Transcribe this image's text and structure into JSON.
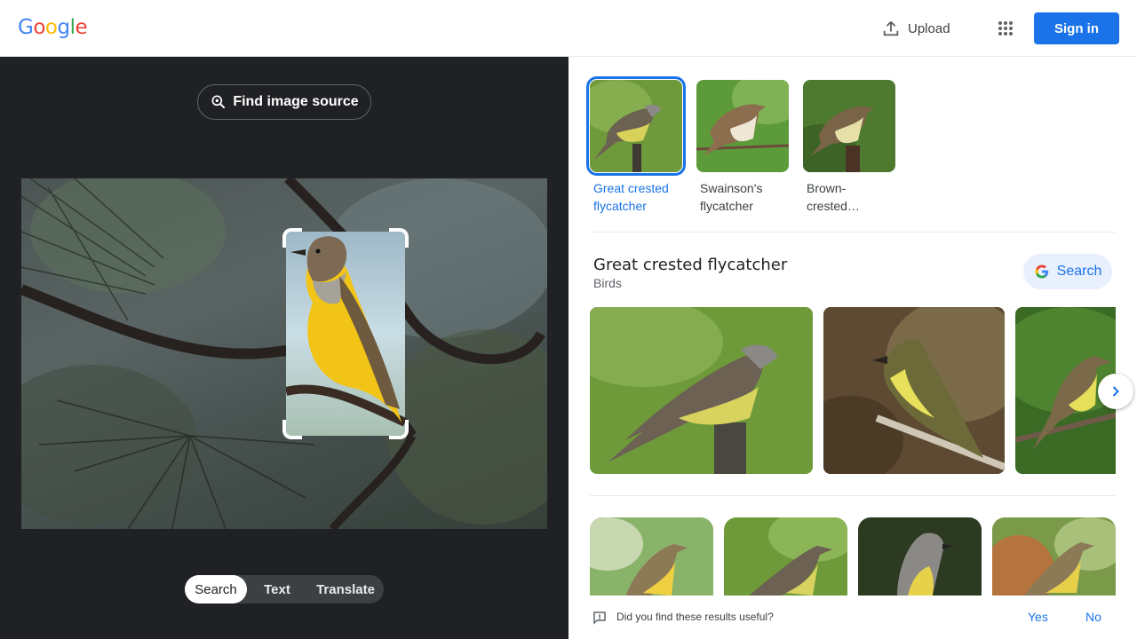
{
  "header": {
    "logo_letters": [
      "G",
      "o",
      "o",
      "g",
      "l",
      "e"
    ],
    "logo_colors": [
      "#4285f4",
      "#ea4335",
      "#fbbc05",
      "#4285f4",
      "#34a853",
      "#ea4335"
    ],
    "upload_label": "Upload",
    "signin_label": "Sign in"
  },
  "left_panel": {
    "find_source_label": "Find image source",
    "modes": [
      "Search",
      "Text",
      "Translate"
    ],
    "selected_mode": "Search"
  },
  "results": {
    "thumbs": [
      {
        "label": "Great crested flycatcher",
        "selected": true
      },
      {
        "label": "Swainson's flycatcher",
        "selected": false
      },
      {
        "label": "Brown-crested…",
        "selected": false
      }
    ],
    "entity": {
      "title": "Great crested flycatcher",
      "subtitle": "Birds",
      "search_label": "Search"
    },
    "feedback": {
      "question": "Did you find these results useful?",
      "yes": "Yes",
      "no": "No"
    }
  },
  "colors": {
    "accent": "#1a73e8",
    "dark_bg": "#202124"
  }
}
